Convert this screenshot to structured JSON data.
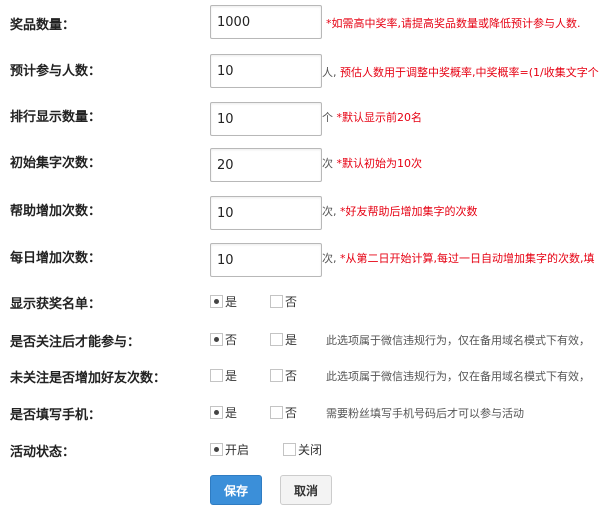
{
  "form": {
    "prize_count": {
      "label": "奖品数量：",
      "value": "1000",
      "suffix": "",
      "hint": "*如需高中奖率,请提高奖品数量或降低预计参与人数."
    },
    "expected_participants": {
      "label": "预计参与人数：",
      "value": "10",
      "suffix": "人,",
      "hint": "预估人数用于调整中奖概率,中奖概率=(1/收集文字个"
    },
    "rank_display": {
      "label": "排行显示数量：",
      "value": "10",
      "suffix": "个",
      "hint": "*默认显示前20名"
    },
    "initial_collect": {
      "label": "初始集字次数：",
      "value": "20",
      "suffix": "次",
      "hint": "*默认初始为10次"
    },
    "help_increase": {
      "label": "帮助增加次数：",
      "value": "10",
      "suffix": "次,",
      "hint": "*好友帮助后增加集字的次数"
    },
    "daily_increase": {
      "label": "每日增加次数：",
      "value": "10",
      "suffix": "次,",
      "hint": "*从第二日开始计算,每过一日自动增加集字的次数,填"
    },
    "show_winners": {
      "label": "显示获奖名单：",
      "options": [
        "是",
        "否"
      ],
      "selected": "是"
    },
    "follow_required": {
      "label": "是否关注后才能参与：",
      "options": [
        "否",
        "是"
      ],
      "selected": "否",
      "note": "此选项属于微信违规行为，仅在备用域名模式下有效，"
    },
    "unfollowed_friend_bonus": {
      "label": "未关注是否增加好友次数：",
      "options": [
        "是",
        "否"
      ],
      "selected": "",
      "note": "此选项属于微信违规行为，仅在备用域名模式下有效，"
    },
    "require_phone": {
      "label": "是否填写手机：",
      "options": [
        "是",
        "否"
      ],
      "selected": "是",
      "note": "需要粉丝填写手机号码后才可以参与活动"
    },
    "activity_status": {
      "label": "活动状态：",
      "options": [
        "开启",
        "关闭"
      ],
      "selected": "开启"
    }
  },
  "buttons": {
    "save": "保存",
    "cancel": "取消"
  },
  "colors": {
    "hint": "#e60012",
    "primary": "#3b8fd9"
  }
}
